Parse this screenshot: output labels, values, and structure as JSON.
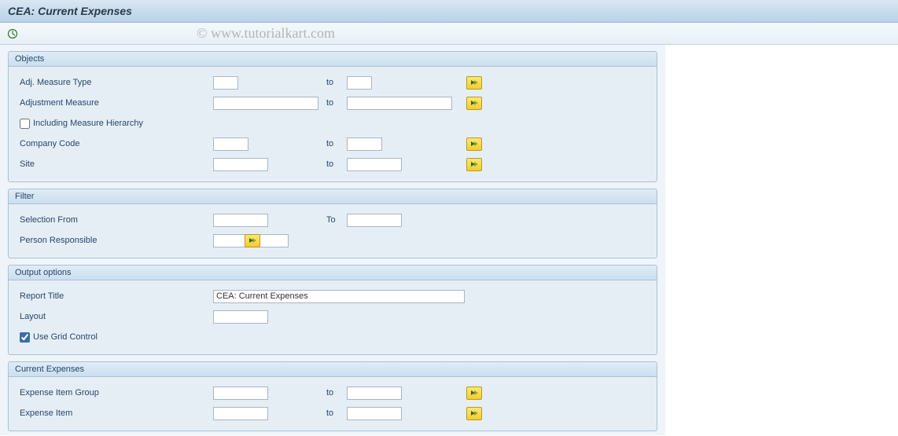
{
  "title": "CEA: Current Expenses",
  "watermark": "© www.tutorialkart.com",
  "groups": {
    "objects": {
      "title": "Objects",
      "adj_measure_type_label": "Adj. Measure Type",
      "adjustment_measure_label": "Adjustment Measure",
      "including_hierarchy_label": "Including Measure Hierarchy",
      "including_hierarchy_checked": false,
      "company_code_label": "Company Code",
      "site_label": "Site",
      "to_label": "to",
      "adj_measure_type_from": "",
      "adj_measure_type_to": "",
      "adjustment_measure_from": "",
      "adjustment_measure_to": "",
      "company_code_from": "",
      "company_code_to": "",
      "site_from": "",
      "site_to": ""
    },
    "filter": {
      "title": "Filter",
      "selection_from_label": "Selection From",
      "to_label": "To",
      "selection_from_value": "",
      "selection_to_value": "",
      "person_responsible_label": "Person Responsible",
      "person_responsible_value": ""
    },
    "output": {
      "title": "Output options",
      "report_title_label": "Report Title",
      "report_title_value": "CEA: Current Expenses",
      "layout_label": "Layout",
      "layout_value": "",
      "use_grid_label": "Use Grid Control",
      "use_grid_checked": true
    },
    "current_expenses": {
      "title": "Current Expenses",
      "to_label": "to",
      "expense_item_group_label": "Expense Item Group",
      "expense_item_group_from": "",
      "expense_item_group_to": "",
      "expense_item_label": "Expense Item",
      "expense_item_from": "",
      "expense_item_to": ""
    }
  }
}
